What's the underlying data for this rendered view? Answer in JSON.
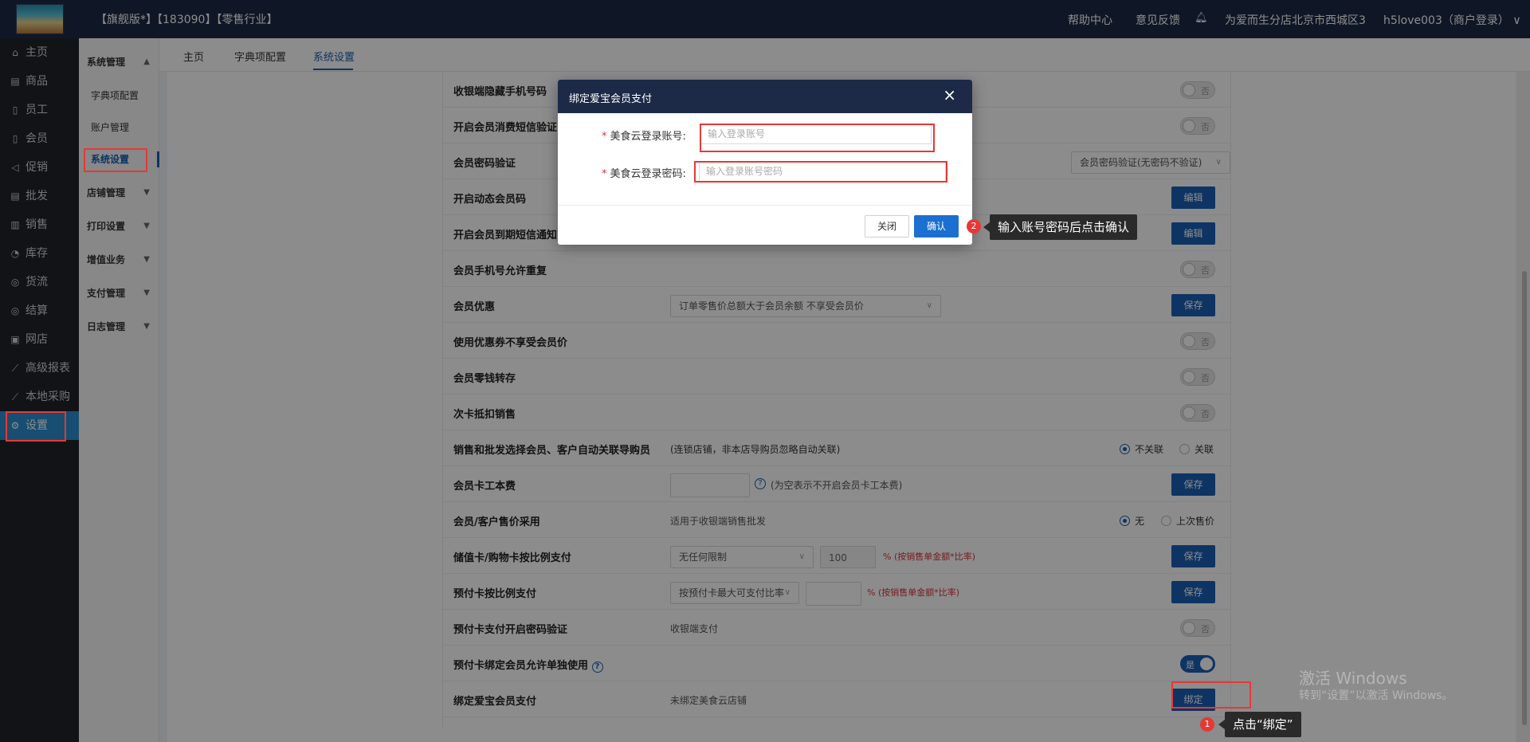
{
  "topbar": {
    "brand": "【旗舰版*】【183090】【零售行业】",
    "help": "帮助中心",
    "feedback": "意见反馈",
    "store": "为爱而生分店北京市西城区3",
    "user": "h5love003（商户登录）"
  },
  "sidebar": {
    "items": [
      {
        "icon": "home-icon",
        "glyph": "⌂",
        "label": "主页"
      },
      {
        "icon": "goods-icon",
        "glyph": "▤",
        "label": "商品"
      },
      {
        "icon": "staff-icon",
        "glyph": "▯",
        "label": "员工"
      },
      {
        "icon": "member-icon",
        "glyph": "▯",
        "label": "会员"
      },
      {
        "icon": "promo-icon",
        "glyph": "◁",
        "label": "促销"
      },
      {
        "icon": "wholesale-icon",
        "glyph": "▤",
        "label": "批发"
      },
      {
        "icon": "sales-icon",
        "glyph": "▥",
        "label": "销售"
      },
      {
        "icon": "stock-icon",
        "glyph": "◔",
        "label": "库存"
      },
      {
        "icon": "logistics-icon",
        "glyph": "◎",
        "label": "货流"
      },
      {
        "icon": "settle-icon",
        "glyph": "◎",
        "label": "结算"
      },
      {
        "icon": "shop-icon",
        "glyph": "▣",
        "label": "网店"
      },
      {
        "icon": "report-icon",
        "glyph": "⟋",
        "label": "高级报表"
      },
      {
        "icon": "purchase-icon",
        "glyph": "⟋",
        "label": "本地采购"
      },
      {
        "icon": "gear-icon",
        "glyph": "⚙",
        "label": "设置"
      }
    ]
  },
  "subnav": {
    "group_system": "系统管理",
    "item_dict": "字典项配置",
    "item_account": "账户管理",
    "item_settings": "系统设置",
    "group_store": "店铺管理",
    "group_print": "打印设置",
    "group_value": "增值业务",
    "group_pay": "支付管理",
    "group_log": "日志管理"
  },
  "tabs": {
    "home": "主页",
    "dict": "字典项配置",
    "settings": "系统设置"
  },
  "settings": {
    "r1_label": "收银端隐藏手机号码",
    "r2_label": "开启会员消费短信验证",
    "r3_label": "会员密码验证",
    "r3_select": "会员密码验证(无密码不验证)",
    "r4_label": "开启动态会员码",
    "r5_label": "开启会员到期短信通知",
    "r6_label": "会员手机号允许重复",
    "r7_label": "会员优惠",
    "r7_select": "订单零售价总额大于会员余额 不享受会员价",
    "r8_label": "使用优惠券不享受会员价",
    "r9_label": "会员零钱转存",
    "r10_label": "次卡抵扣销售",
    "r11_label": "销售和批发选择会员、客户自动关联导购员",
    "r11_note": "(连锁店铺，非本店导购员忽略自动关联)",
    "r11_opt1": "不关联",
    "r11_opt2": "关联",
    "r12_label": "会员卡工本费",
    "r12_help": "?",
    "r12_note": "(为空表示不开启会员卡工本费)",
    "r13_label": "会员/客户售价采用",
    "r13_note": "适用于收银端销售批发",
    "r13_opt1": "无",
    "r13_opt2": "上次售价",
    "r14_label": "储值卡/购物卡按比例支付",
    "r14_select": "无任何限制",
    "r14_value": "100",
    "r14_note": "% (按销售单金额*比率)",
    "r15_label": "预付卡按比例支付",
    "r15_select": "按预付卡最大可支付比率",
    "r15_note": "% (按销售单金额*比率)",
    "r16_label": "预付卡支付开启密码验证",
    "r16_note": "收银端支付",
    "r17_label": "预付卡绑定会员允许单独使用",
    "r17_help": "?",
    "r18_label": "绑定爱宝会员支付",
    "r18_note": "未绑定美食云店铺",
    "toggle_off": "否",
    "toggle_on": "是",
    "btn_edit": "编辑",
    "btn_save": "保存",
    "btn_bind": "绑定"
  },
  "dialog": {
    "title": "绑定爱宝会员支付",
    "close": "×",
    "account_label": "美食云登录账号:",
    "account_placeholder": "输入登录账号",
    "password_label": "美食云登录密码:",
    "password_placeholder": "输入登录账号密码",
    "required_mark": "*",
    "btn_close": "关闭",
    "btn_ok": "确认"
  },
  "annotations": {
    "step1_num": "1",
    "step1_text": "点击“绑定”",
    "step2_num": "2",
    "step2_text": "输入账号密码后点击确认",
    "accent": "#e53935"
  },
  "watermark": {
    "line1": "激活 Windows",
    "line2": "转到“设置”以激活 Windows。"
  }
}
